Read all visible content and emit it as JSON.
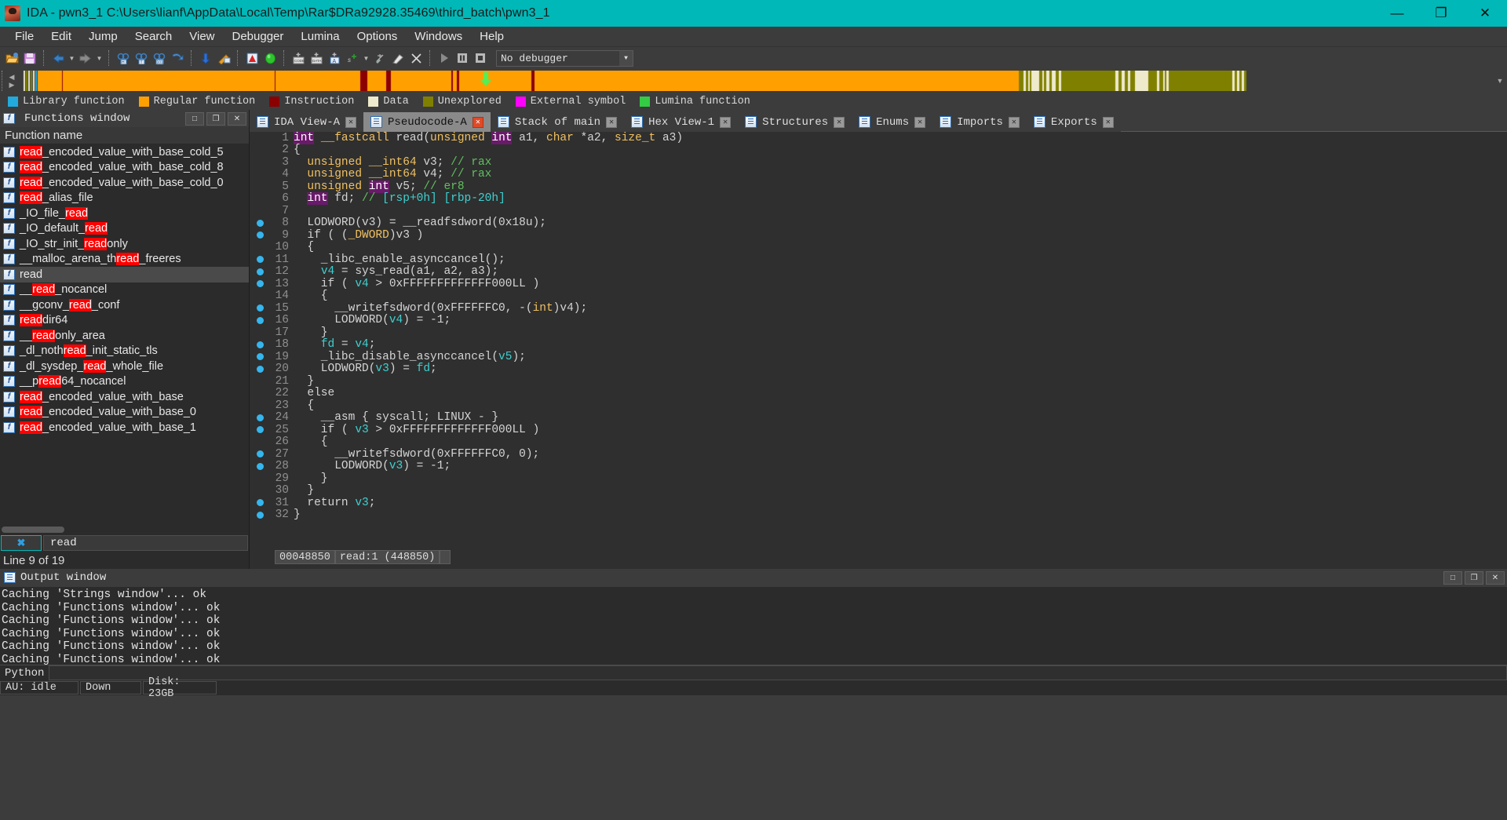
{
  "window": {
    "title": "IDA - pwn3_1 C:\\Users\\lianf\\AppData\\Local\\Temp\\Rar$DRa92928.35469\\third_batch\\pwn3_1",
    "minimize": "—",
    "maximize": "❐",
    "close": "✕"
  },
  "menu": [
    "File",
    "Edit",
    "Jump",
    "Search",
    "View",
    "Debugger",
    "Lumina",
    "Options",
    "Windows",
    "Help"
  ],
  "toolbar": {
    "debugger_selector": "No debugger",
    "icons": [
      "open-folder-icon",
      "save-icon",
      "sep",
      "back-arrow-icon",
      "back-dropdown-icon",
      "forward-arrow-icon",
      "forward-dropdown-icon",
      "sep",
      "search-hex-icon",
      "search-text-icon",
      "search-binary-icon",
      "jump-icon",
      "sep",
      "down-arrow-icon",
      "edit-function-icon",
      "sep",
      "warning-icon",
      "green-circle-icon",
      "sep",
      "make-code-icon",
      "make-data-icon",
      "make-ascii-icon",
      "make-struct-icon",
      "struct-dropdown-icon",
      "undefine-icon",
      "rename-icon",
      "delete-icon",
      "sep",
      "run-icon",
      "pause-icon",
      "stop-icon"
    ]
  },
  "legend": [
    {
      "label": "Library function",
      "color": "#22aadd"
    },
    {
      "label": "Regular function",
      "color": "#ffa000"
    },
    {
      "label": "Instruction",
      "color": "#8b0000"
    },
    {
      "label": "Data",
      "color": "#eeeacb"
    },
    {
      "label": "Unexplored",
      "color": "#808000"
    },
    {
      "label": "External symbol",
      "color": "#ff00ff"
    },
    {
      "label": "Lumina function",
      "color": "#33cc44"
    }
  ],
  "functions_panel": {
    "title": "Functions window",
    "column_header": "Function name",
    "panel_buttons": [
      "□",
      "❐",
      "✕"
    ],
    "filter_clear_label": "✖",
    "filter_value": "read",
    "status": "Line 9 of 19",
    "highlight_color": "#ff0000",
    "items": [
      {
        "name": "read_encoded_value_with_base_cold_5",
        "hl": [
          [
            0,
            4
          ]
        ],
        "selected": false
      },
      {
        "name": "read_encoded_value_with_base_cold_8",
        "hl": [
          [
            0,
            4
          ]
        ],
        "selected": false
      },
      {
        "name": "read_encoded_value_with_base_cold_0",
        "hl": [
          [
            0,
            4
          ]
        ],
        "selected": false
      },
      {
        "name": "read_alias_file",
        "hl": [
          [
            0,
            4
          ]
        ],
        "selected": false
      },
      {
        "name": "_IO_file_read",
        "hl": [
          [
            9,
            13
          ]
        ],
        "selected": false
      },
      {
        "name": "_IO_default_read",
        "hl": [
          [
            12,
            16
          ]
        ],
        "selected": false
      },
      {
        "name": "_IO_str_init_readonly",
        "hl": [
          [
            13,
            17
          ]
        ],
        "selected": false
      },
      {
        "name": "__malloc_arena_thread_freeres",
        "hl": [
          [
            17,
            21
          ]
        ],
        "selected": false
      },
      {
        "name": "read",
        "hl": [],
        "selected": true
      },
      {
        "name": "__read_nocancel",
        "hl": [
          [
            2,
            6
          ]
        ],
        "selected": false
      },
      {
        "name": "__gconv_read_conf",
        "hl": [
          [
            8,
            12
          ]
        ],
        "selected": false
      },
      {
        "name": "readdir64",
        "hl": [
          [
            0,
            4
          ]
        ],
        "selected": false
      },
      {
        "name": "__readonly_area",
        "hl": [
          [
            2,
            6
          ]
        ],
        "selected": false
      },
      {
        "name": "_dl_nothread_init_static_tls",
        "hl": [
          [
            8,
            12
          ]
        ],
        "selected": false
      },
      {
        "name": "_dl_sysdep_read_whole_file",
        "hl": [
          [
            11,
            15
          ]
        ],
        "selected": false
      },
      {
        "name": "__pread64_nocancel",
        "hl": [
          [
            3,
            7
          ]
        ],
        "selected": false
      },
      {
        "name": "read_encoded_value_with_base",
        "hl": [
          [
            0,
            4
          ]
        ],
        "selected": false
      },
      {
        "name": "read_encoded_value_with_base_0",
        "hl": [
          [
            0,
            4
          ]
        ],
        "selected": false
      },
      {
        "name": "read_encoded_value_with_base_1",
        "hl": [
          [
            0,
            4
          ]
        ],
        "selected": false
      }
    ]
  },
  "tabs": [
    {
      "label": "IDA View-A",
      "active": false,
      "close": "✕"
    },
    {
      "label": "Pseudocode-A",
      "active": true,
      "close": "✕"
    },
    {
      "label": "Stack of main",
      "active": false,
      "close": "✕"
    },
    {
      "label": "Hex View-1",
      "active": false,
      "close": "✕"
    },
    {
      "label": "Structures",
      "active": false,
      "close": "✕"
    },
    {
      "label": "Enums",
      "active": false,
      "close": "✕"
    },
    {
      "label": "Imports",
      "active": false,
      "close": "✕"
    },
    {
      "label": "Exports",
      "active": false,
      "close": "✕"
    }
  ],
  "pseudocode": {
    "status_cells": [
      "00048850",
      "read:1 (448850)",
      ""
    ],
    "lines": [
      {
        "n": 1,
        "bp": false,
        "tokens": [
          [
            "kw",
            "int"
          ],
          [
            "t",
            " "
          ],
          [
            "ty",
            "__fastcall"
          ],
          [
            "t",
            " read("
          ],
          [
            "ty",
            "unsigned"
          ],
          [
            "t",
            " "
          ],
          [
            "kw",
            "int"
          ],
          [
            "t",
            " a1, "
          ],
          [
            "ty",
            "char"
          ],
          [
            "t",
            " *a2, "
          ],
          [
            "ty",
            "size_t"
          ],
          [
            "t",
            " a3)"
          ]
        ]
      },
      {
        "n": 2,
        "bp": false,
        "tokens": [
          [
            "t",
            "{"
          ]
        ]
      },
      {
        "n": 3,
        "bp": false,
        "tokens": [
          [
            "t",
            "  "
          ],
          [
            "ty",
            "unsigned"
          ],
          [
            "t",
            " "
          ],
          [
            "ty",
            "__int64"
          ],
          [
            "t",
            " v3; "
          ],
          [
            "cm",
            "// rax"
          ]
        ]
      },
      {
        "n": 4,
        "bp": false,
        "tokens": [
          [
            "t",
            "  "
          ],
          [
            "ty",
            "unsigned"
          ],
          [
            "t",
            " "
          ],
          [
            "ty",
            "__int64"
          ],
          [
            "t",
            " v4; "
          ],
          [
            "cm",
            "// rax"
          ]
        ]
      },
      {
        "n": 5,
        "bp": false,
        "tokens": [
          [
            "t",
            "  "
          ],
          [
            "ty",
            "unsigned"
          ],
          [
            "t",
            " "
          ],
          [
            "kw",
            "int"
          ],
          [
            "t",
            " v5; "
          ],
          [
            "cm",
            "// er8"
          ]
        ]
      },
      {
        "n": 6,
        "bp": false,
        "tokens": [
          [
            "t",
            "  "
          ],
          [
            "kw",
            "int"
          ],
          [
            "t",
            " fd; "
          ],
          [
            "cm",
            "// "
          ],
          [
            "va",
            "[rsp+0h] [rbp-20h]"
          ]
        ]
      },
      {
        "n": 7,
        "bp": false,
        "tokens": []
      },
      {
        "n": 8,
        "bp": true,
        "tokens": [
          [
            "t",
            "  LODWORD(v3) = __readfsdword(0x18u);"
          ]
        ]
      },
      {
        "n": 9,
        "bp": true,
        "tokens": [
          [
            "t",
            "  if ( ("
          ],
          [
            "ty",
            "_DWORD"
          ],
          [
            "t",
            ")v3 )"
          ]
        ]
      },
      {
        "n": 10,
        "bp": false,
        "tokens": [
          [
            "t",
            "  {"
          ]
        ]
      },
      {
        "n": 11,
        "bp": true,
        "tokens": [
          [
            "t",
            "    _libc_enable_asynccancel();"
          ]
        ]
      },
      {
        "n": 12,
        "bp": true,
        "tokens": [
          [
            "t",
            "    "
          ],
          [
            "va",
            "v4"
          ],
          [
            "t",
            " = sys_read(a1, a2, a3);"
          ]
        ]
      },
      {
        "n": 13,
        "bp": true,
        "tokens": [
          [
            "t",
            "    if ( "
          ],
          [
            "va",
            "v4"
          ],
          [
            "t",
            " > 0xFFFFFFFFFFFFF000LL )"
          ]
        ]
      },
      {
        "n": 14,
        "bp": false,
        "tokens": [
          [
            "t",
            "    {"
          ]
        ]
      },
      {
        "n": 15,
        "bp": true,
        "tokens": [
          [
            "t",
            "      __writefsdword(0xFFFFFFC0, -("
          ],
          [
            "ty",
            "int"
          ],
          [
            "t",
            ")v4);"
          ]
        ]
      },
      {
        "n": 16,
        "bp": true,
        "tokens": [
          [
            "t",
            "      LODWORD("
          ],
          [
            "va",
            "v4"
          ],
          [
            "t",
            ") = -1;"
          ]
        ]
      },
      {
        "n": 17,
        "bp": false,
        "tokens": [
          [
            "t",
            "    }"
          ]
        ]
      },
      {
        "n": 18,
        "bp": true,
        "tokens": [
          [
            "t",
            "    "
          ],
          [
            "va",
            "fd"
          ],
          [
            "t",
            " = "
          ],
          [
            "va",
            "v4"
          ],
          [
            "t",
            ";"
          ]
        ]
      },
      {
        "n": 19,
        "bp": true,
        "tokens": [
          [
            "t",
            "    _libc_disable_asynccancel("
          ],
          [
            "va",
            "v5"
          ],
          [
            "t",
            ");"
          ]
        ]
      },
      {
        "n": 20,
        "bp": true,
        "tokens": [
          [
            "t",
            "    LODWORD("
          ],
          [
            "va",
            "v3"
          ],
          [
            "t",
            ") = "
          ],
          [
            "va",
            "fd"
          ],
          [
            "t",
            ";"
          ]
        ]
      },
      {
        "n": 21,
        "bp": false,
        "tokens": [
          [
            "t",
            "  }"
          ]
        ]
      },
      {
        "n": 22,
        "bp": false,
        "tokens": [
          [
            "t",
            "  else"
          ]
        ]
      },
      {
        "n": 23,
        "bp": false,
        "tokens": [
          [
            "t",
            "  {"
          ]
        ]
      },
      {
        "n": 24,
        "bp": true,
        "tokens": [
          [
            "t",
            "    __asm { syscall; LINUX - }"
          ]
        ]
      },
      {
        "n": 25,
        "bp": true,
        "tokens": [
          [
            "t",
            "    if ( "
          ],
          [
            "va",
            "v3"
          ],
          [
            "t",
            " > 0xFFFFFFFFFFFFF000LL )"
          ]
        ]
      },
      {
        "n": 26,
        "bp": false,
        "tokens": [
          [
            "t",
            "    {"
          ]
        ]
      },
      {
        "n": 27,
        "bp": true,
        "tokens": [
          [
            "t",
            "      __writefsdword(0xFFFFFFC0, 0);"
          ]
        ]
      },
      {
        "n": 28,
        "bp": true,
        "tokens": [
          [
            "t",
            "      LODWORD("
          ],
          [
            "va",
            "v3"
          ],
          [
            "t",
            ") = -1;"
          ]
        ]
      },
      {
        "n": 29,
        "bp": false,
        "tokens": [
          [
            "t",
            "    }"
          ]
        ]
      },
      {
        "n": 30,
        "bp": false,
        "tokens": [
          [
            "t",
            "  }"
          ]
        ]
      },
      {
        "n": 31,
        "bp": true,
        "tokens": [
          [
            "t",
            "  return "
          ],
          [
            "va",
            "v3"
          ],
          [
            "t",
            ";"
          ]
        ]
      },
      {
        "n": 32,
        "bp": true,
        "tokens": [
          [
            "t",
            "}"
          ]
        ]
      }
    ]
  },
  "output_window": {
    "title": "Output window",
    "panel_buttons": [
      "□",
      "❐",
      "✕"
    ],
    "lines": [
      "Caching 'Strings window'... ok",
      "Caching 'Functions window'... ok",
      "Caching 'Functions window'... ok",
      "Caching 'Functions window'... ok",
      "Caching 'Functions window'... ok",
      "Caching 'Functions window'... ok"
    ],
    "python_label": "Python",
    "python_value": ""
  },
  "statusbar": [
    "AU: idle",
    "Down",
    "Disk: 23GB"
  ]
}
